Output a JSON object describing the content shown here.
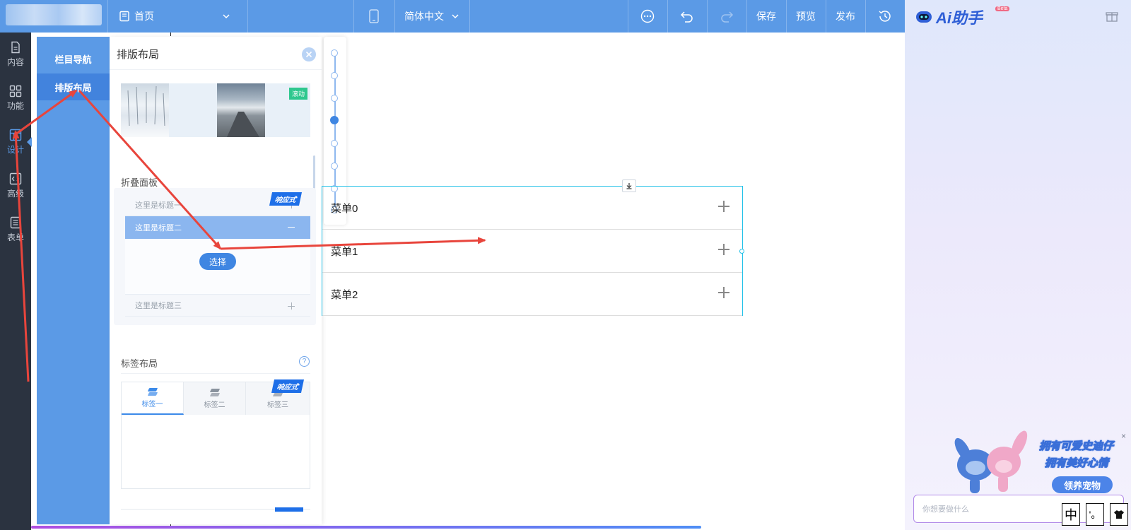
{
  "topbar": {
    "page_select": "首页",
    "language": "简体中文",
    "save": "保存",
    "preview": "预览",
    "publish": "发布",
    "bg": "#5b9ae6"
  },
  "rail": {
    "items": [
      {
        "label": "内容",
        "icon": "document-icon"
      },
      {
        "label": "功能",
        "icon": "grid-icon"
      },
      {
        "label": "设计",
        "icon": "layout-icon"
      },
      {
        "label": "高级",
        "icon": "code-icon"
      },
      {
        "label": "表单",
        "icon": "form-icon"
      }
    ],
    "active_index": 2
  },
  "categories": {
    "items": [
      "栏目导航",
      "排版布局"
    ],
    "active_index": 1
  },
  "panel": {
    "title": "排版布局",
    "scroll_tag": "滚动",
    "accordion": {
      "title": "折叠面板",
      "badge": "响应式",
      "items": [
        "这里是标题一",
        "这里是标题二",
        "这里是标题三"
      ],
      "select_button": "选择"
    },
    "tabs_layout": {
      "title": "标签布局",
      "badge": "响应式",
      "tabs": [
        "标签一",
        "标签二",
        "标签三"
      ]
    }
  },
  "canvas": {
    "menus": [
      "菜单0",
      "菜单1",
      "菜单2"
    ]
  },
  "ai": {
    "title": "Ai助手",
    "beta": "Beta",
    "promo_line1": "拥有可爱史迪仔",
    "promo_line2": "拥有美好心情",
    "promo_button": "领养宠物",
    "input_placeholder": "你想要做什么",
    "ime": [
      "中",
      "'。",
      "👕"
    ]
  },
  "colors": {
    "accent": "#5b9ae6",
    "selection": "#23c1e8",
    "arrow": "#e8453c"
  }
}
